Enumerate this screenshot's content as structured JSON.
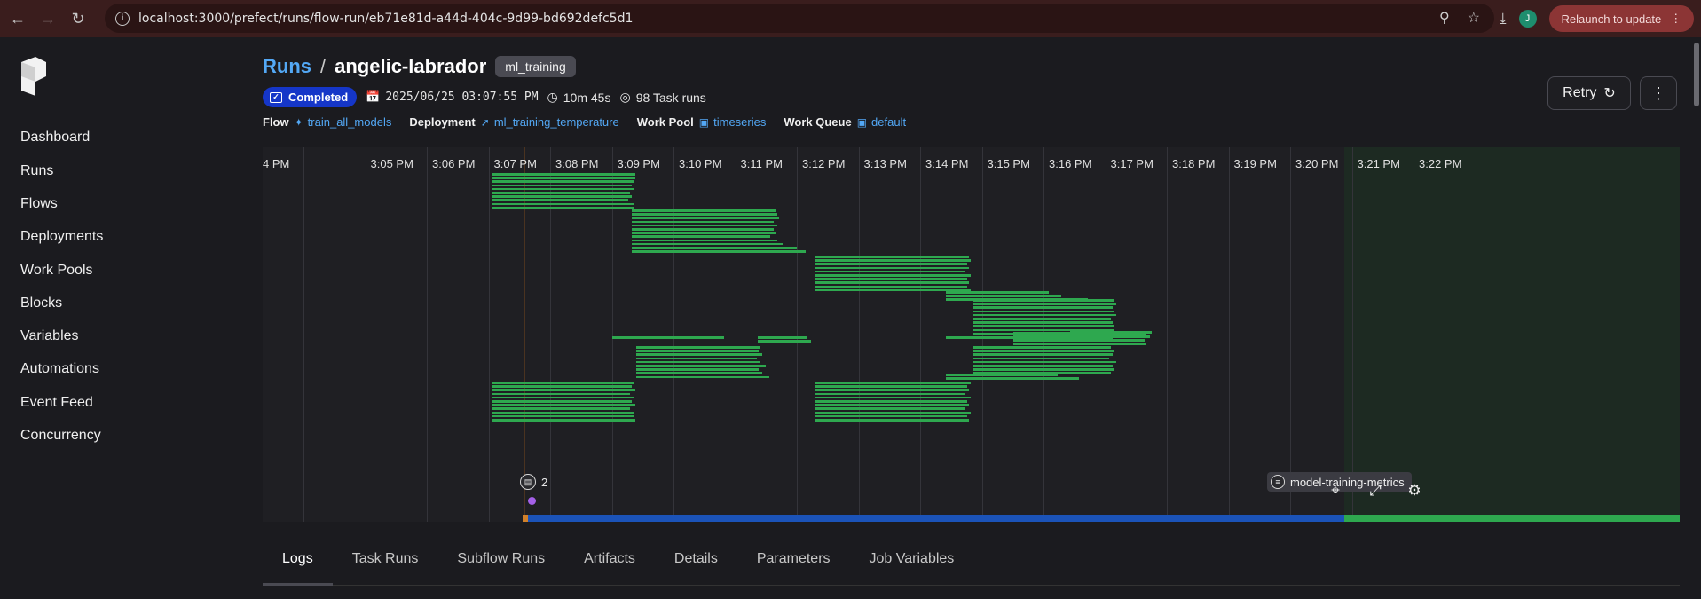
{
  "browser": {
    "url": "localhost:3000/prefect/runs/flow-run/eb71e81d-a44d-404c-9d99-bd692defc5d1",
    "relaunch_label": "Relaunch to update",
    "profile_initial": "J"
  },
  "sidebar": {
    "items": [
      {
        "label": "Dashboard"
      },
      {
        "label": "Runs"
      },
      {
        "label": "Flows"
      },
      {
        "label": "Deployments"
      },
      {
        "label": "Work Pools"
      },
      {
        "label": "Blocks"
      },
      {
        "label": "Variables"
      },
      {
        "label": "Automations"
      },
      {
        "label": "Event Feed"
      },
      {
        "label": "Concurrency"
      }
    ]
  },
  "header": {
    "breadcrumb_root": "Runs",
    "separator": "/",
    "run_name": "angelic-labrador",
    "tag": "ml_training",
    "status": "Completed",
    "start_time": "2025/06/25 03:07:55 PM",
    "duration": "10m 45s",
    "task_runs": "98 Task runs",
    "flow_label": "Flow",
    "flow_value": "train_all_models",
    "deployment_label": "Deployment",
    "deployment_value": "ml_training_temperature",
    "work_pool_label": "Work Pool",
    "work_pool_value": "timeseries",
    "work_queue_label": "Work Queue",
    "work_queue_value": "default",
    "retry_label": "Retry"
  },
  "timeline": {
    "ticks": [
      "4 PM",
      "3:05 PM",
      "3:06 PM",
      "3:07 PM",
      "3:08 PM",
      "3:09 PM",
      "3:10 PM",
      "3:11 PM",
      "3:12 PM",
      "3:13 PM",
      "3:14 PM",
      "3:15 PM",
      "3:16 PM",
      "3:17 PM",
      "3:18 PM",
      "3:19 PM",
      "3:20 PM",
      "3:21 PM",
      "3:22 PM"
    ],
    "event_count": "2",
    "artifact_label": "model-training-metrics",
    "colors": {
      "task_bar": "#2ea84f",
      "running": "#1b53b8",
      "future": "#1d2a22"
    }
  },
  "tabs": [
    {
      "label": "Logs",
      "active": true
    },
    {
      "label": "Task Runs"
    },
    {
      "label": "Subflow Runs"
    },
    {
      "label": "Artifacts"
    },
    {
      "label": "Details"
    },
    {
      "label": "Parameters"
    },
    {
      "label": "Job Variables"
    }
  ]
}
